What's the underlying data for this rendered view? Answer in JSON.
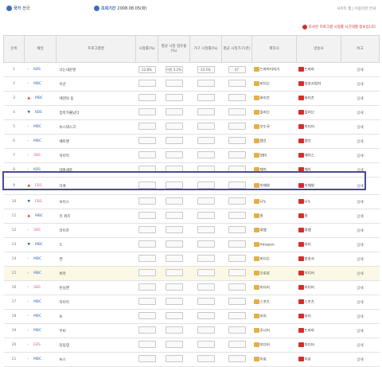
{
  "top": {
    "filter_label": "국가",
    "filter_value": "전국",
    "period_label": "조회기간",
    "period_value": "2008.08.05(화)",
    "links": "사이트 맵 | 이용약관 안내",
    "notice": "조사된 프로그램 시청률 시간대별 정보입니다"
  },
  "columns": [
    "순위",
    "채널",
    "프로그램명",
    "시청률(%)",
    "평균 시청 점유율(%)",
    "가구 시청률(%)",
    "평균 시청가구(천)",
    "제작사",
    "방송사",
    "비고"
  ],
  "rows": [
    {
      "rank": "1",
      "chg": "-",
      "chg_dir": "",
      "ch": "KBS",
      "title": "너는내운명",
      "v": [
        "12.8%",
        "이전 3.2%",
        "23.5%",
        "47"
      ],
      "pd": "드라마이야기",
      "bc": "드라마",
      "note": "상세"
    },
    {
      "rank": "2",
      "chg": "-",
      "chg_dir": "",
      "ch": "MBC",
      "title": "이산",
      "v": [
        "",
        "",
        "",
        ""
      ],
      "pd": "비디오",
      "bc": "방송사업자",
      "note": "상세"
    },
    {
      "rank": "3",
      "chg": "▲",
      "chg_dir": "up",
      "ch": "MBC",
      "title": "에덴의 동",
      "v": [
        "",
        "",
        "",
        ""
      ],
      "pd": "와이즈",
      "bc": "와이즈",
      "note": "상세"
    },
    {
      "rank": "4",
      "chg": "▼",
      "chg_dir": "dn",
      "ch": "KBS",
      "title": "엄마가뿔났다",
      "v": [
        "",
        "",
        "",
        ""
      ],
      "pd": "올리브",
      "bc": "올리브",
      "note": "상세"
    },
    {
      "rank": "5",
      "chg": "-",
      "chg_dir": "",
      "ch": "MBC",
      "title": "뉴스데스크",
      "v": [
        "",
        "",
        "",
        ""
      ],
      "pd": "보도국",
      "bc": "미디어",
      "note": "상세"
    },
    {
      "rank": "6",
      "chg": "-",
      "chg_dir": "",
      "ch": "MBC",
      "title": "베토벤",
      "v": [
        "",
        "",
        "",
        ""
      ],
      "pd": "캠프",
      "bc": "캠프",
      "note": "상세"
    },
    {
      "rank": "7",
      "chg": "-",
      "chg_dir": "",
      "ch": "SBS",
      "title": "하이킥",
      "v": [
        "",
        "",
        "",
        ""
      ],
      "pd": "SBS",
      "bc": "에이스",
      "note": "상세"
    },
    {
      "rank": "8",
      "chg": "-",
      "chg_dir": "",
      "ch": "KBS",
      "title": "대왕세종",
      "v": [
        "",
        "",
        "",
        ""
      ],
      "pd": "제이",
      "bc": "제이",
      "note": "상세"
    },
    {
      "rank": "9",
      "chg": "▲",
      "chg_dir": "up",
      "ch": "EBS",
      "title": "다큐",
      "v": [
        "",
        "",
        "",
        ""
      ],
      "pd": "이재영",
      "bc": "이재영",
      "note": "상세",
      "selected": true
    },
    {
      "rank": "10",
      "chg": "▼",
      "chg_dir": "dn",
      "ch": "EBS",
      "title": "보이스",
      "v": [
        "",
        "",
        "",
        ""
      ],
      "pd": "나노",
      "bc": "나노",
      "note": "상세"
    },
    {
      "rank": "11",
      "chg": "▲",
      "chg_dir": "up",
      "ch": "MBC",
      "title": "유 퀴즈",
      "v": [
        "",
        "",
        "",
        ""
      ],
      "pd": "원",
      "bc": "원",
      "note": "상세"
    },
    {
      "rank": "12",
      "chg": "-",
      "chg_dir": "",
      "ch": "SBS",
      "title": "라이프",
      "v": [
        "",
        "",
        "",
        ""
      ],
      "pd": "여행",
      "bc": "여행",
      "note": "상세"
    },
    {
      "rank": "13",
      "chg": "▼",
      "chg_dir": "dn",
      "ch": "MBC",
      "title": "드",
      "v": [
        "",
        "",
        "",
        ""
      ],
      "pd": "Amazon",
      "bc": "아이",
      "note": "상세"
    },
    {
      "rank": "14",
      "chg": "-",
      "chg_dir": "",
      "ch": "MBC",
      "title": "연",
      "v": [
        "",
        "",
        "",
        ""
      ],
      "pd": "비디오",
      "bc": "방송사",
      "note": "상세"
    },
    {
      "rank": "15",
      "chg": "-",
      "chg_dir": "",
      "ch": "MBC",
      "title": "버라",
      "v": [
        "",
        "",
        "",
        ""
      ],
      "pd": "오로로",
      "bc": "미디어",
      "note": "상세",
      "yellow": true
    },
    {
      "rank": "16",
      "chg": "-",
      "chg_dir": "",
      "ch": "SBS",
      "title": "런닝맨",
      "v": [
        "",
        "",
        "",
        ""
      ],
      "pd": "미디어",
      "bc": "미디어",
      "note": "상세"
    },
    {
      "rank": "17",
      "chg": "-",
      "chg_dir": "",
      "ch": "MBC",
      "title": "하이킥",
      "v": [
        "",
        "",
        "",
        ""
      ],
      "pd": "스포츠",
      "bc": "스포츠",
      "note": "상세"
    },
    {
      "rank": "18",
      "chg": "-",
      "chg_dir": "",
      "ch": "MBC",
      "title": "뉴",
      "v": [
        "",
        "",
        "",
        ""
      ],
      "pd": "아이",
      "bc": "아이",
      "note": "상세"
    },
    {
      "rank": "19",
      "chg": "-",
      "chg_dir": "",
      "ch": "MBC",
      "title": "무비",
      "v": [
        "",
        "",
        "",
        ""
      ],
      "pd": "주니어",
      "bc": "드라마",
      "note": "상세"
    },
    {
      "rank": "20",
      "chg": "-",
      "chg_dir": "",
      "ch": "EBS",
      "title": "딩동댕",
      "v": [
        "",
        "",
        "",
        ""
      ],
      "pd": "미디어",
      "bc": "미디어",
      "note": "상세"
    },
    {
      "rank": "21",
      "chg": "-",
      "chg_dir": "",
      "ch": "MBC",
      "title": "뉴스",
      "v": [
        "",
        "",
        "",
        ""
      ],
      "pd": "이로",
      "bc": "이로",
      "note": "상세"
    }
  ]
}
